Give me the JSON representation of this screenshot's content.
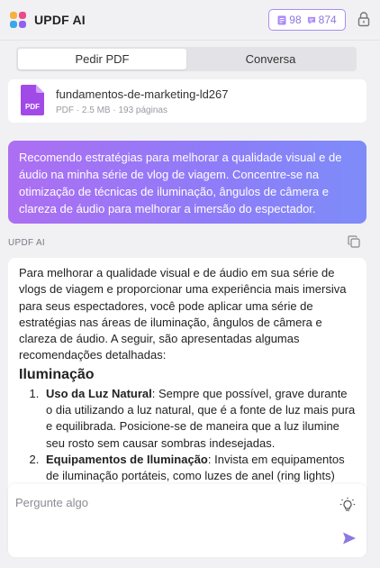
{
  "header": {
    "title": "UPDF AI",
    "credits": [
      {
        "icon": "document-credit-icon",
        "value": "98"
      },
      {
        "icon": "chat-credit-icon",
        "value": "874"
      }
    ]
  },
  "tabs": [
    {
      "label": "Pedir PDF",
      "active": true
    },
    {
      "label": "Conversa",
      "active": false
    }
  ],
  "file": {
    "name": "fundamentos-de-marketing-ld267",
    "meta": "PDF · 2.5 MB · 193 páginas",
    "icon_label": "PDF"
  },
  "user_message": "Recomendo estratégias para melhorar a qualidade visual e de áudio na minha série de vlog de viagem. Concentre-se na otimização de técnicas de iluminação, ângulos de câmera e clareza de áudio para melhorar a imersão do espectador.",
  "assistant": {
    "label": "UPDF AI",
    "intro": "Para melhorar a qualidade visual e de áudio em sua série de vlogs de viagem e proporcionar uma experiência mais imersiva para seus espectadores, você pode aplicar uma série de estratégias nas áreas de iluminação, ângulos de câmera e clareza de áudio. A seguir, são apresentadas algumas recomendações detalhadas:",
    "section_title": "Iluminação",
    "items": [
      {
        "key": "Uso da Luz Natural",
        "text": ": Sempre que possível, grave durante o dia utilizando a luz natural, que é a fonte de luz mais pura e equilibrada. Posicione-se de maneira que a luz ilumine seu rosto sem causar sombras indesejadas."
      },
      {
        "key": "Equipamentos de Iluminação",
        "text": ": Invista em equipamentos de iluminação portáteis, como luzes de anel (ring lights)"
      }
    ]
  },
  "input": {
    "placeholder": "Pergunte algo"
  },
  "colors": {
    "accent": "#8d77e0",
    "gradient_start": "#ad6ef2",
    "gradient_end": "#7e8cf8",
    "pdf_icon": "#a24ae8"
  }
}
